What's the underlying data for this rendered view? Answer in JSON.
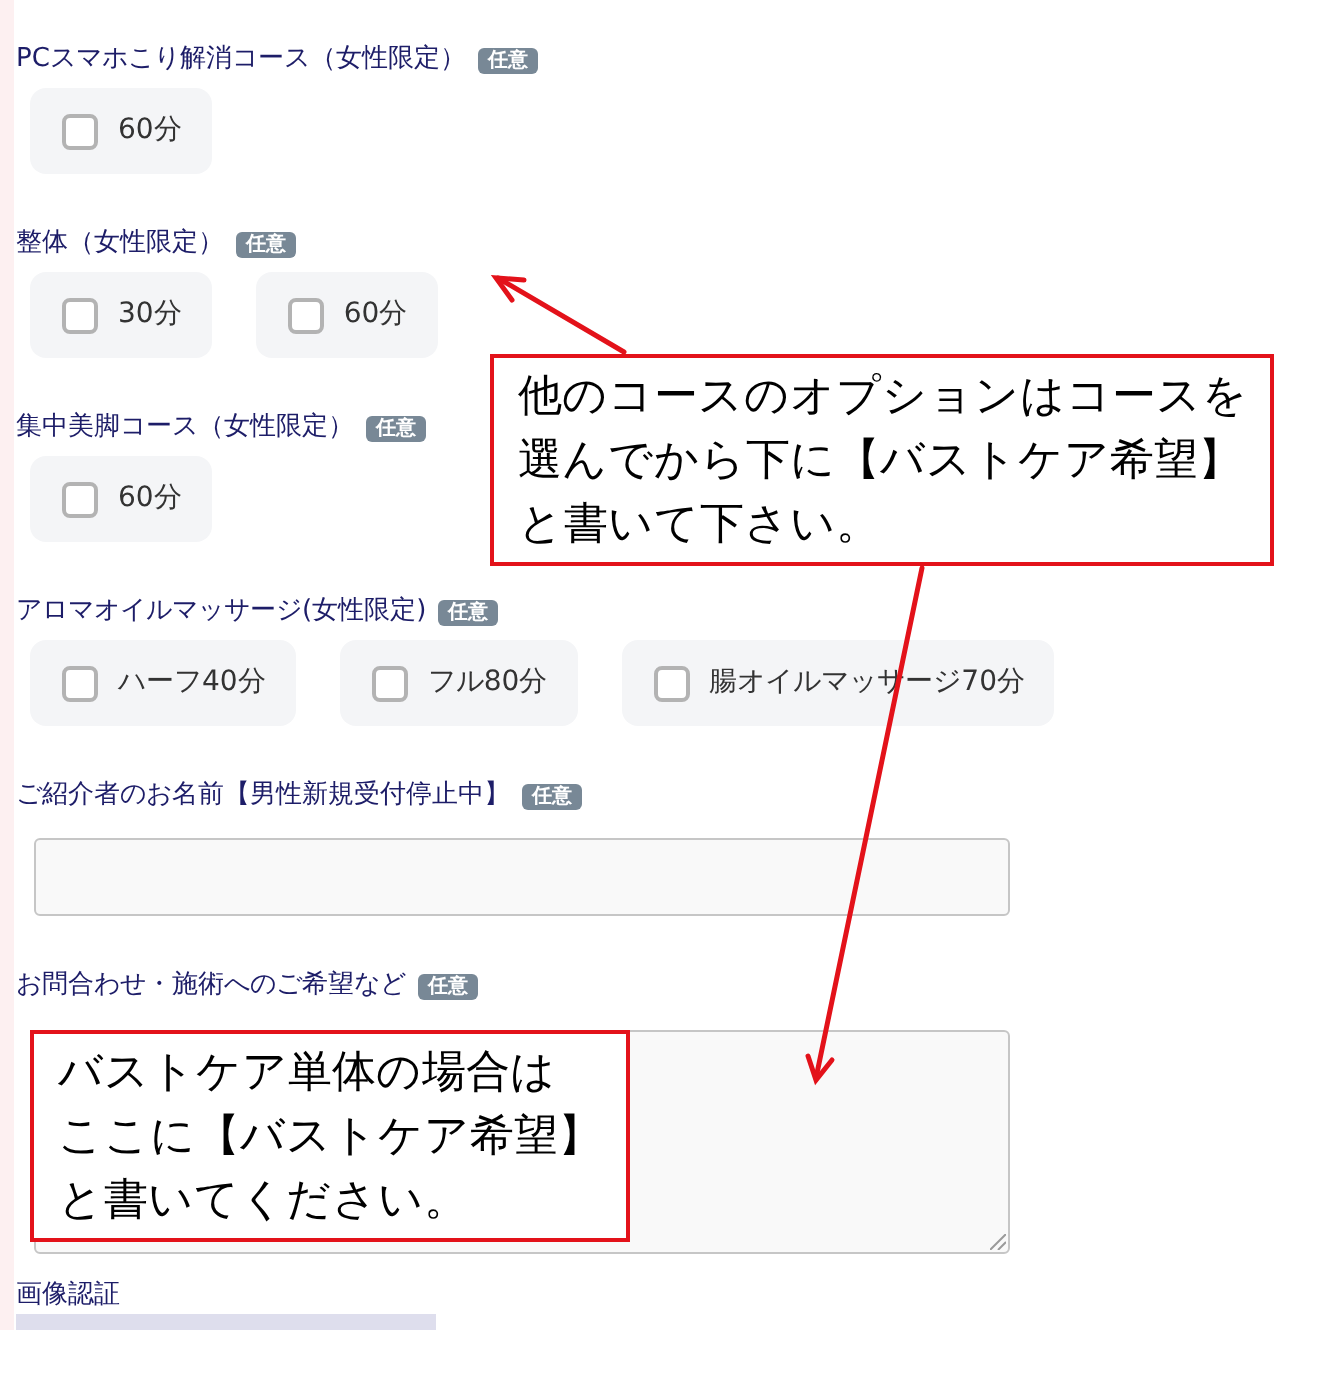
{
  "sections": [
    {
      "label": "PCスマホこり解消コース（女性限定）",
      "badge": "任意",
      "kind": "checkboxes",
      "options": [
        {
          "label": "60分",
          "checked": false
        }
      ]
    },
    {
      "label": "整体（女性限定）",
      "badge": "任意",
      "kind": "checkboxes",
      "options": [
        {
          "label": "30分",
          "checked": false
        },
        {
          "label": "60分",
          "checked": false
        }
      ]
    },
    {
      "label": "集中美脚コース（女性限定）",
      "badge": "任意",
      "kind": "checkboxes",
      "options": [
        {
          "label": "60分",
          "checked": false
        }
      ]
    },
    {
      "label": "アロマオイルマッサージ(女性限定)",
      "badge": "任意",
      "kind": "checkboxes",
      "options": [
        {
          "label": "ハーフ40分",
          "checked": false
        },
        {
          "label": "フル80分",
          "checked": false
        },
        {
          "label": "腸オイルマッサージ70分",
          "checked": false
        }
      ]
    },
    {
      "label": "ご紹介者のお名前【男性新規受付停止中】",
      "badge": "任意",
      "kind": "text_input"
    },
    {
      "label": "お問合わせ・施術へのご希望など",
      "badge": "任意",
      "kind": "textarea"
    },
    {
      "label": "画像認証",
      "kind": "captcha"
    }
  ],
  "annotations": [
    {
      "text": "他のコースのオプションはコースを選んでから下に【バストケア希望】と書いて下さい。"
    },
    {
      "text": "バストケア単体の場合はここに【バストケア希望】と書いてください。"
    }
  ]
}
